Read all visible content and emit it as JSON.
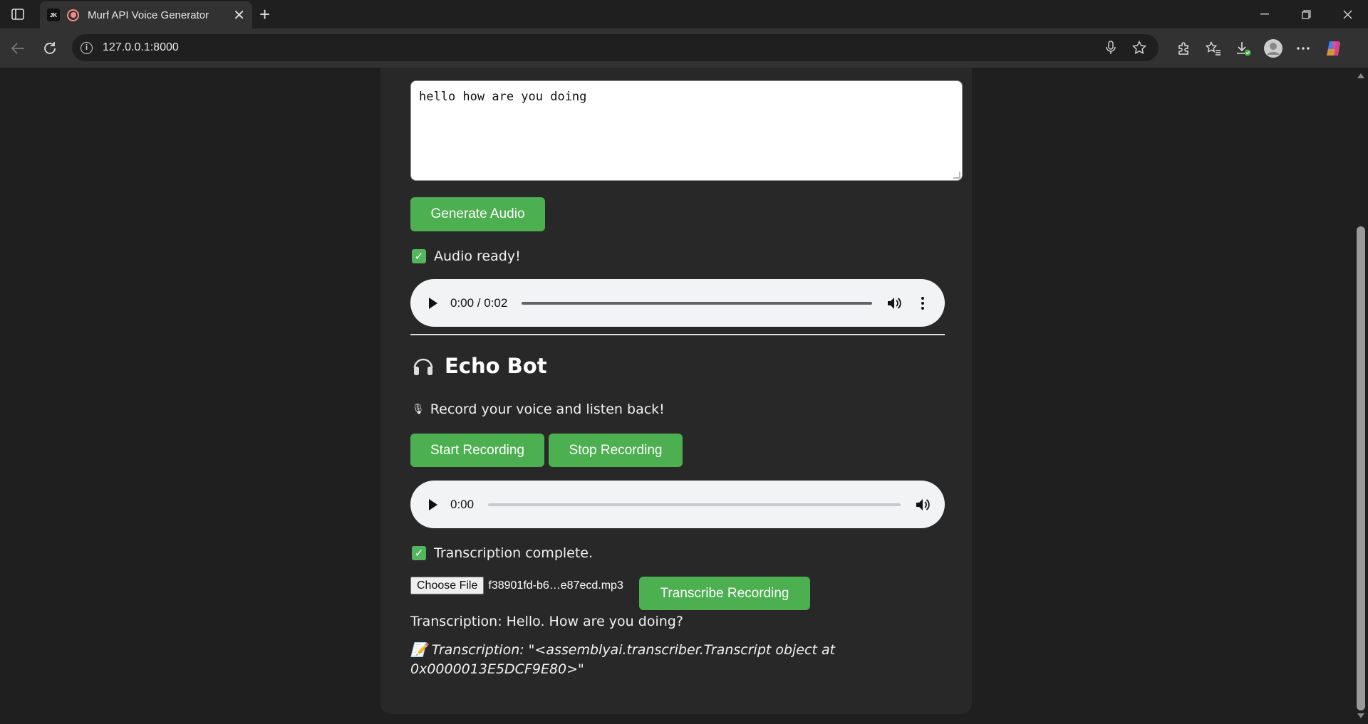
{
  "browser": {
    "tab_favicon_text": "JK",
    "tab_title": "Murf API Voice Generator",
    "url": "127.0.0.1:8000"
  },
  "tts": {
    "text_value": "hello how are you doing",
    "generate_label": "Generate Audio",
    "status_text": "Audio ready!",
    "player_time": "0:00 / 0:02"
  },
  "echo": {
    "title": "Echo Bot",
    "subtitle": "Record your voice and listen back!",
    "start_label": "Start Recording",
    "stop_label": "Stop Recording",
    "player_time": "0:00",
    "status_text": "Transcription complete.",
    "choose_file_label": "Choose File",
    "file_name": "f38901fd-b6…e87ecd.mp3",
    "transcribe_label": "Transcribe Recording",
    "transcription_text": "Transcription: Hello. How are you doing?",
    "transcription_object_text": "Transcription: \"<assemblyai.transcriber.Transcript object at 0x0000013E5DCF9E80>\""
  },
  "colors": {
    "accent_green": "#4caf50",
    "page_bg": "#1f1f1f",
    "card_bg": "#282828"
  }
}
